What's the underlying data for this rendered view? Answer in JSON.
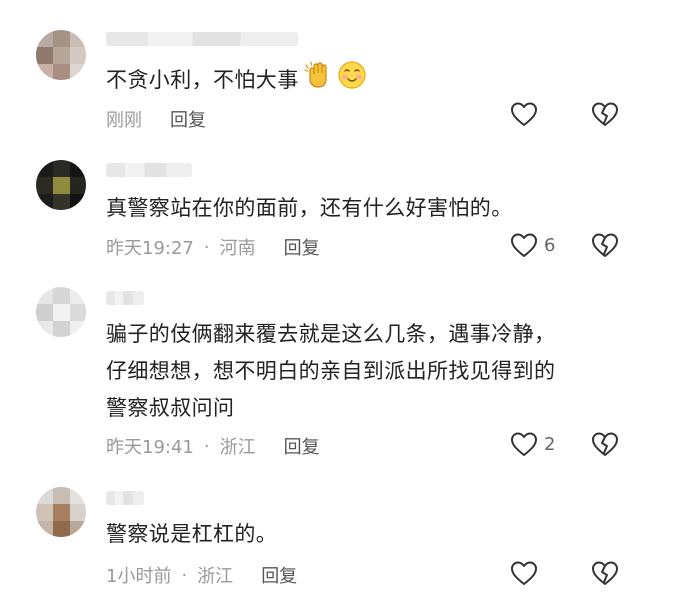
{
  "comments": [
    {
      "text_lines": [
        "不贪小利，不怕大事"
      ],
      "time": "刚刚",
      "location": "",
      "reply": "回复",
      "likes": "",
      "emojis": [
        "clapping-hands-emoji",
        "smiling-face-emoji"
      ]
    },
    {
      "text_lines": [
        "真警察站在你的面前，还有什么好害怕的。"
      ],
      "time": "昨天19:27",
      "location": "河南",
      "reply": "回复",
      "likes": "6"
    },
    {
      "text_lines": [
        "骗子的伎俩翻来覆去就是这么几条，遇事冷静，",
        "仔细想想，想不明白的亲自到派出所找见得到的",
        "警察叔叔问问"
      ],
      "time": "昨天19:41",
      "location": "浙江",
      "reply": "回复",
      "likes": "2"
    },
    {
      "text_lines": [
        "警察说是杠杠的。"
      ],
      "time": "1小时前",
      "location": "浙江",
      "reply": "回复",
      "likes": ""
    }
  ],
  "meta_separator": "·",
  "icons": {
    "like": "heart-outline-icon",
    "dislike": "broken-heart-icon"
  },
  "colors": {
    "text": "#222222",
    "meta": "#9a9a9a",
    "reply": "#555555",
    "icon_stroke": "#333333"
  }
}
